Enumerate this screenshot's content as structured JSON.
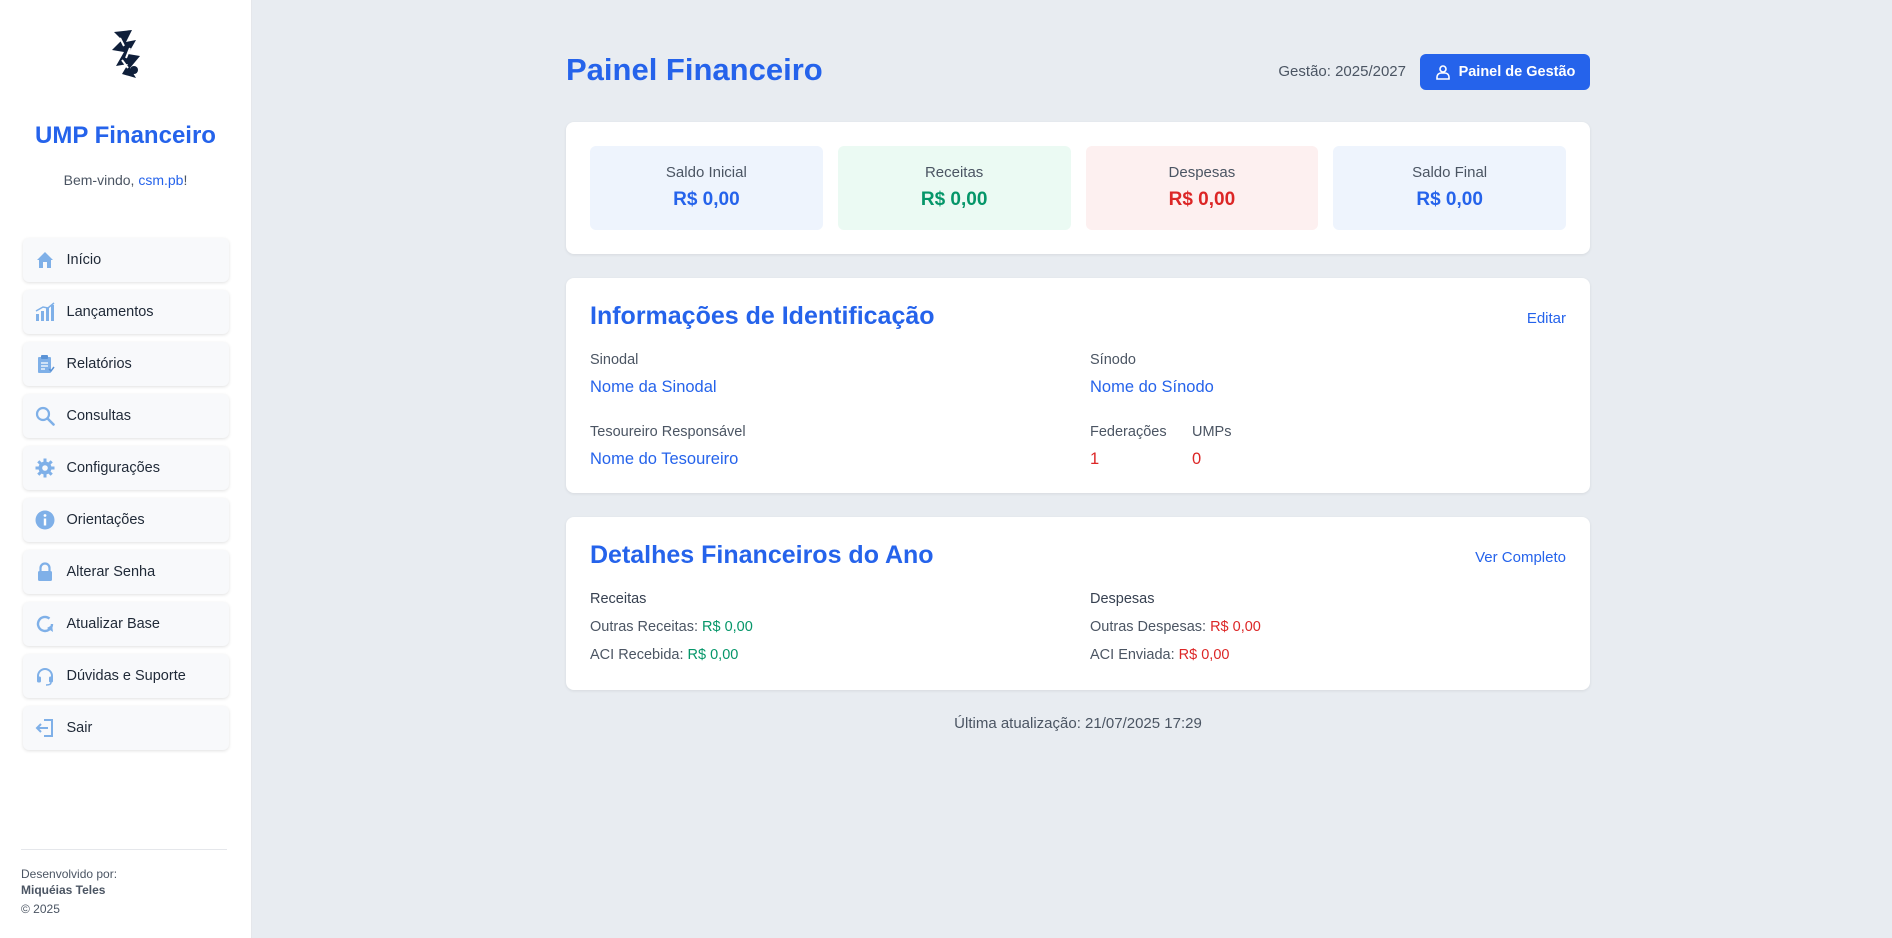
{
  "sidebar": {
    "title": "UMP Financeiro",
    "welcome_prefix": "Bem-vindo, ",
    "username": "csm.pb",
    "welcome_suffix": "!",
    "items": [
      {
        "label": "Início",
        "icon": "home-icon"
      },
      {
        "label": "Lançamentos",
        "icon": "chart-bars-icon"
      },
      {
        "label": "Relatórios",
        "icon": "clipboard-icon"
      },
      {
        "label": "Consultas",
        "icon": "search-icon"
      },
      {
        "label": "Configurações",
        "icon": "gear-icon"
      },
      {
        "label": "Orientações",
        "icon": "info-icon"
      },
      {
        "label": "Alterar Senha",
        "icon": "lock-icon"
      },
      {
        "label": "Atualizar Base",
        "icon": "refresh-icon"
      },
      {
        "label": "Dúvidas e Suporte",
        "icon": "headset-icon"
      },
      {
        "label": "Sair",
        "icon": "logout-icon"
      }
    ],
    "footer": {
      "developed_by": "Desenvolvido por:",
      "developer": "Miquéias Teles",
      "copyright": "© 2025"
    }
  },
  "header": {
    "title": "Painel Financeiro",
    "gestao": "Gestão: 2025/2027",
    "button_label": "Painel de Gestão"
  },
  "summary": [
    {
      "label": "Saldo Inicial",
      "value": "R$ 0,00"
    },
    {
      "label": "Receitas",
      "value": "R$ 0,00"
    },
    {
      "label": "Despesas",
      "value": "R$ 0,00"
    },
    {
      "label": "Saldo Final",
      "value": "R$ 0,00"
    }
  ],
  "identification": {
    "title": "Informações de Identificação",
    "edit_label": "Editar",
    "sinodal_label": "Sinodal",
    "sinodal_value": "Nome da Sinodal",
    "sinodo_label": "Sínodo",
    "sinodo_value": "Nome do Sínodo",
    "tesoureiro_label": "Tesoureiro Responsável",
    "tesoureiro_value": "Nome do Tesoureiro",
    "federacoes_label": "Federações",
    "federacoes_value": "1",
    "umps_label": "UMPs",
    "umps_value": "0"
  },
  "details": {
    "title": "Detalhes Financeiros do Ano",
    "link_label": "Ver Completo",
    "receitas_header": "Receitas",
    "outras_receitas_label": "Outras Receitas: ",
    "outras_receitas_value": "R$ 0,00",
    "aci_recebida_label": "ACI Recebida: ",
    "aci_recebida_value": "R$ 0,00",
    "despesas_header": "Despesas",
    "outras_despesas_label": "Outras Despesas: ",
    "outras_despesas_value": "R$ 0,00",
    "aci_enviada_label": "ACI Enviada: ",
    "aci_enviada_value": "R$ 0,00"
  },
  "footer": {
    "last_update": "Última atualização: 21/07/2025 17:29"
  },
  "colors": {
    "accent": "#2563eb",
    "positive": "#059669",
    "negative": "#dc2626",
    "background": "#e8ecf1"
  }
}
